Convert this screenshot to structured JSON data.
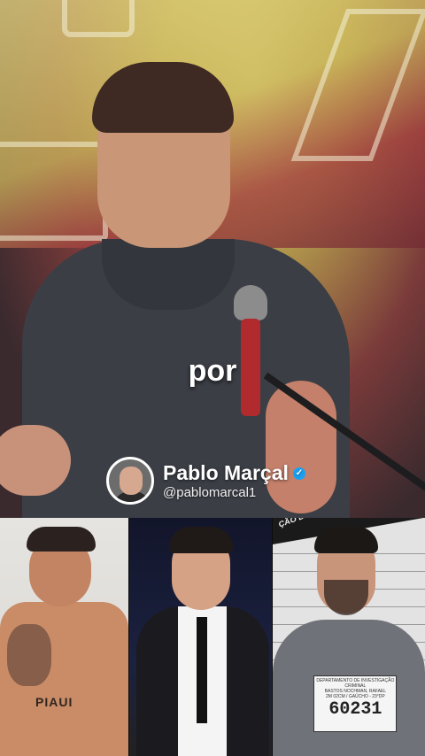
{
  "caption": "por",
  "credit": {
    "name": "Pablo Marçal",
    "handle": "@pablomarcal1",
    "verified_color": "#1da1f2"
  },
  "panels": [
    {
      "id": "left",
      "text": "PIAUI"
    },
    {
      "id": "middle",
      "text": ""
    },
    {
      "id": "right",
      "banner": "ÇÃO DE\n P COMEDY",
      "placard_title": "DEPARTAMENTO DE INVESTIGAÇÃO CRIMINAL",
      "placard_line1": "BASTOS NOCHMAN, RAFAEL",
      "placard_line2": "2M 02CM / GAÚCHO - 23°DP",
      "placard_number": "60231"
    }
  ]
}
